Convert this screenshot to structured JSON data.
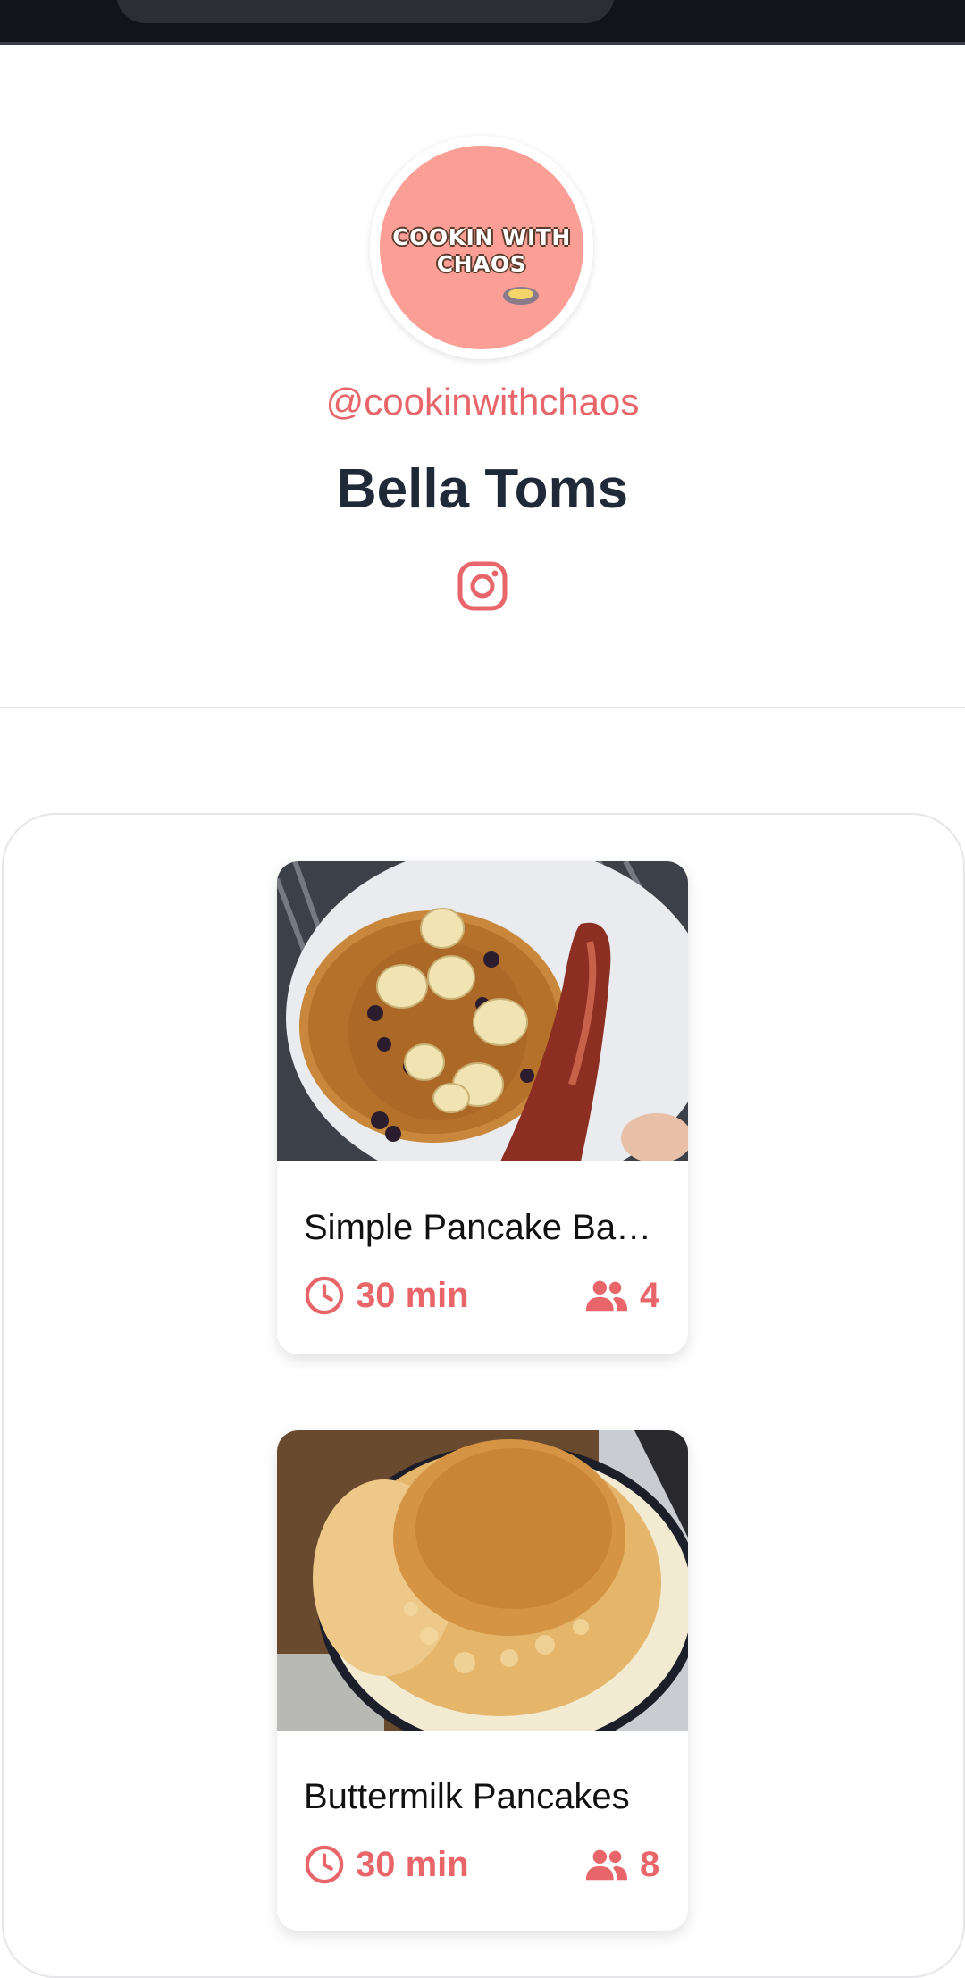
{
  "profile": {
    "avatar_text_line1": "COOKIN WITH",
    "avatar_text_line2": "CHAOS",
    "handle": "@cookinwithchaos",
    "name": "Bella Toms",
    "social_icon": "instagram-icon"
  },
  "recipes": [
    {
      "title": "Simple Pancake Ba…",
      "time": "30 min",
      "servings": "4"
    },
    {
      "title": "Buttermilk Pancakes",
      "time": "30 min",
      "servings": "8"
    }
  ],
  "colors": {
    "accent": "#e8666a",
    "avatar_bg": "#fa9e96",
    "name_text": "#1f2937",
    "topbar": "#12141b"
  }
}
